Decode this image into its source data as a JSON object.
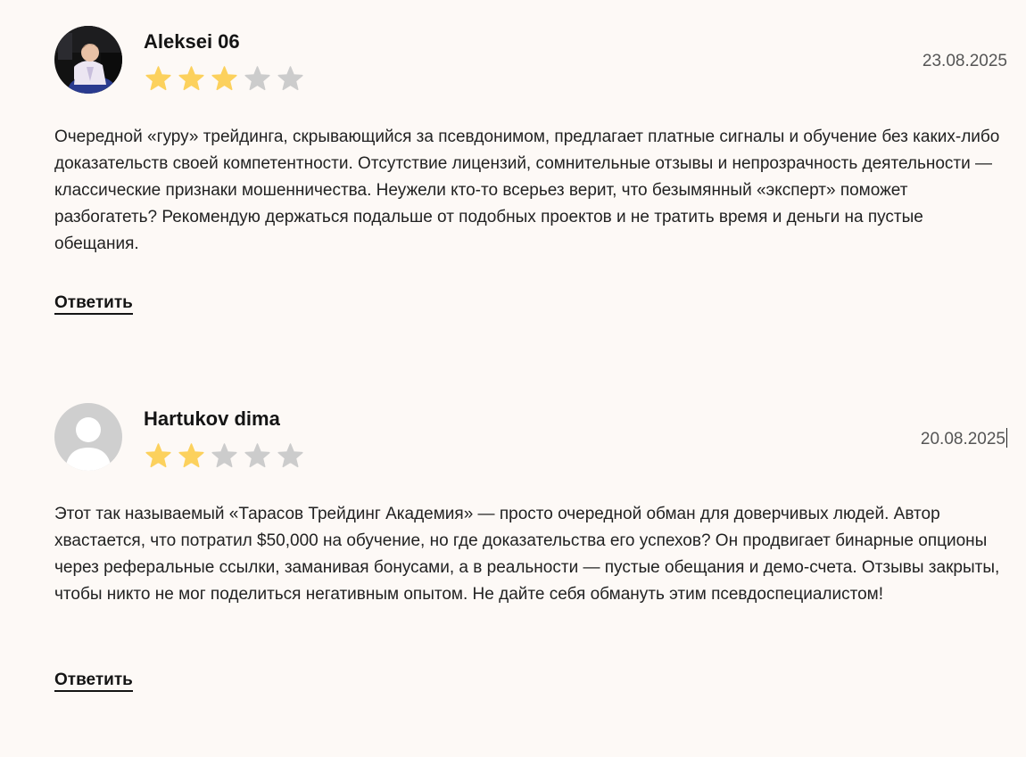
{
  "reviews": [
    {
      "author": "Aleksei 06",
      "date": "23.08.2025",
      "rating": 3,
      "max_rating": 5,
      "avatar": "photo-avatar",
      "text": "Очередной «гуру» трейдинга, скрывающийся за псевдонимом, предлагает платные сигналы и обучение без каких-либо доказательств своей компетентности. Отсутствие лицензий, сомнительные отзывы и непрозрачность деятельности — классические признаки мошенничества. Неужели кто-то всерьез верит, что безымянный «эксперт» поможет разбогатеть? Рекомендую держаться подальше от подобных проектов и не тратить время и деньги на пустые обещания.",
      "reply_label": "Ответить"
    },
    {
      "author": "Hartukov dima",
      "date": "20.08.2025",
      "rating": 2,
      "max_rating": 5,
      "avatar": "default-user-avatar",
      "text": "Этот так называемый «Тарасов Трейдинг Академия» — просто очередной обман для доверчивых людей. Автор хвастается, что потратил $50,000 на обучение, но где доказательства его успехов? Он продвигает бинарные опционы через реферальные ссылки, заманивая бонусами, а в реальности — пустые обещания и демо-счета. Отзывы закрыты, чтобы никто не мог поделиться негативным опытом. Не дайте себя обмануть этим псевдоспециалистом!",
      "reply_label": "Ответить"
    }
  ],
  "colors": {
    "background": "#fdf9f6",
    "star_filled": "#fcd15d",
    "star_empty": "#cccccc",
    "text": "#222222"
  },
  "icons": {
    "star": "star-icon",
    "avatar_placeholder": "user-silhouette-icon"
  }
}
